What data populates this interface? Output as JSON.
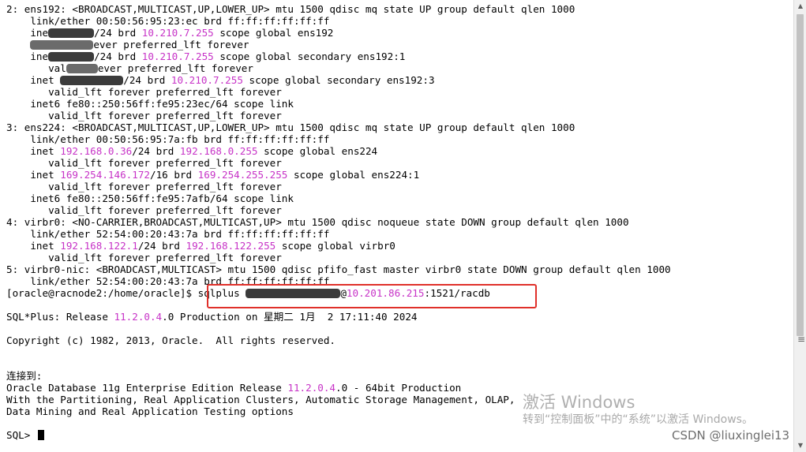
{
  "terminal": {
    "l1": {
      "a": "2: ens192: <BROADCAST,MULTICAST,UP,LOWER_UP> mtu 1500 qdisc mq state UP group default qlen 1000"
    },
    "l2": {
      "a": "    link/ether 00:50:56:95:23:ec brd ff:ff:ff:ff:ff:ff"
    },
    "l3": {
      "a": "    ine",
      "b": "/24 brd ",
      "c": "10.210.7.255",
      "d": " scope global ens192"
    },
    "l4": {
      "a": "    ",
      "b": "ever preferred_lft forever"
    },
    "l5": {
      "a": "    ine",
      "b": "/24 brd ",
      "c": "10.210.7.255",
      "d": " scope global secondary ens192:1"
    },
    "l6": {
      "a": "       val",
      "b": "ever preferred_lft forever"
    },
    "l7": {
      "a": "    inet ",
      "b": "/24 brd ",
      "c": "10.210.7.255",
      "d": " scope global secondary ens192:3"
    },
    "l8": {
      "a": "       valid_lft forever preferred_lft forever"
    },
    "l9": {
      "a": "    inet6 fe80::250:56ff:fe95:23ec/64 scope link"
    },
    "l10": {
      "a": "       valid_lft forever preferred_lft forever"
    },
    "l11": {
      "a": "3: ens224: <BROADCAST,MULTICAST,UP,LOWER_UP> mtu 1500 qdisc mq state UP group default qlen 1000"
    },
    "l12": {
      "a": "    link/ether 00:50:56:95:7a:fb brd ff:ff:ff:ff:ff:ff"
    },
    "l13": {
      "a": "    inet ",
      "b": "192.168.0.36",
      "c": "/24 brd ",
      "d": "192.168.0.255",
      "e": " scope global ens224"
    },
    "l14": {
      "a": "       valid_lft forever preferred_lft forever"
    },
    "l15": {
      "a": "    inet ",
      "b": "169.254.146.172",
      "c": "/16 brd ",
      "d": "169.254.255.255",
      "e": " scope global ens224:1"
    },
    "l16": {
      "a": "       valid_lft forever preferred_lft forever"
    },
    "l17": {
      "a": "    inet6 fe80::250:56ff:fe95:7afb/64 scope link"
    },
    "l18": {
      "a": "       valid_lft forever preferred_lft forever"
    },
    "l19": {
      "a": "4: virbr0: <NO-CARRIER,BROADCAST,MULTICAST,UP> mtu 1500 qdisc noqueue state DOWN group default qlen 1000"
    },
    "l20": {
      "a": "    link/ether 52:54:00:20:43:7a brd ff:ff:ff:ff:ff:ff"
    },
    "l21": {
      "a": "    inet ",
      "b": "192.168.122.1",
      "c": "/24 brd ",
      "d": "192.168.122.255",
      "e": " scope global virbr0"
    },
    "l22": {
      "a": "       valid_lft forever preferred_lft forever"
    },
    "l23": {
      "a": "5: virbr0-nic: <BROADCAST,MULTICAST> mtu 1500 qdisc pfifo_fast master virbr0 state DOWN group default qlen 1000"
    },
    "l24": {
      "a": "    link/ether 52:54:00:20:43:7a brd ff:ff:ff:ff:ff:ff"
    },
    "prompt": "[oracle@racnode2:/home/oracle]$ ",
    "command_pre": "sqlplus ",
    "command_at": "@",
    "command_host": "10.201.86.215",
    "command_post": ":1521/racdb",
    "release_pre": "SQL*Plus: Release ",
    "release_version": "11.2.0.4",
    "release_post": ".0 Production on 星期二 1月  2 17:11:40 2024",
    "copyright": "Copyright (c) 1982, 2013, Oracle.  All rights reserved.",
    "connected": "连接到:",
    "db_pre": "Oracle Database 11g Enterprise Edition Release ",
    "db_version": "11.2.0.4",
    "db_post": ".0 - 64bit Production",
    "options1": "With the Partitioning, Real Application Clusters, Automatic Storage Management, OLAP,",
    "options2": "Data Mining and Real Application Testing options",
    "sql_prompt": "SQL> "
  },
  "watermark": {
    "title": "激活 Windows",
    "subtitle": "转到“控制面板”中的“系统”以激活 Windows。"
  },
  "attribution": "CSDN @liuxinglei13",
  "scrollbar": {
    "up_icon": "▲",
    "down_icon": "▼",
    "grip": "≡"
  }
}
